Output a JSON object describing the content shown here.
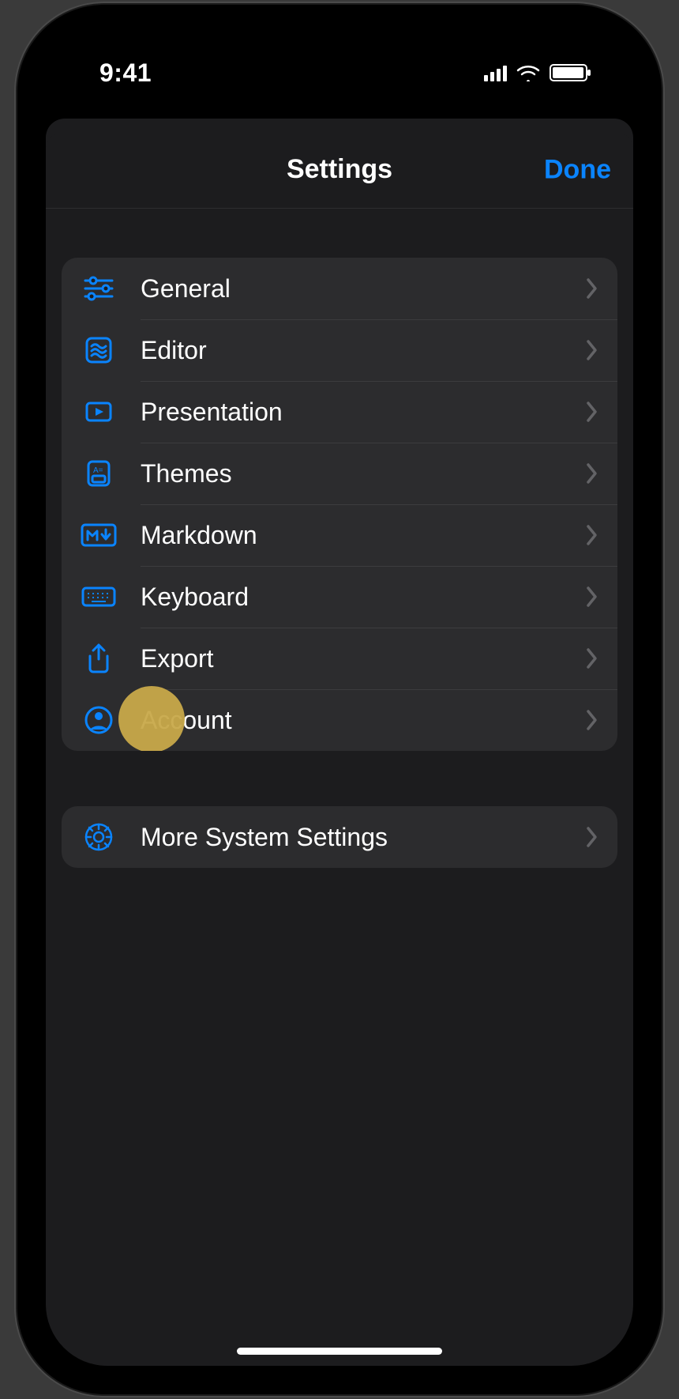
{
  "status": {
    "time": "9:41"
  },
  "nav": {
    "title": "Settings",
    "done": "Done"
  },
  "group1": {
    "items": [
      {
        "label": "General",
        "icon": "sliders-icon"
      },
      {
        "label": "Editor",
        "icon": "editor-icon"
      },
      {
        "label": "Presentation",
        "icon": "play-square-icon"
      },
      {
        "label": "Themes",
        "icon": "themes-icon"
      },
      {
        "label": "Markdown",
        "icon": "markdown-icon"
      },
      {
        "label": "Keyboard",
        "icon": "keyboard-icon"
      },
      {
        "label": "Export",
        "icon": "export-icon"
      },
      {
        "label": "Account",
        "icon": "account-icon"
      }
    ]
  },
  "group2": {
    "items": [
      {
        "label": "More System Settings",
        "icon": "gear-icon"
      }
    ]
  },
  "accent": "#0a84ff"
}
